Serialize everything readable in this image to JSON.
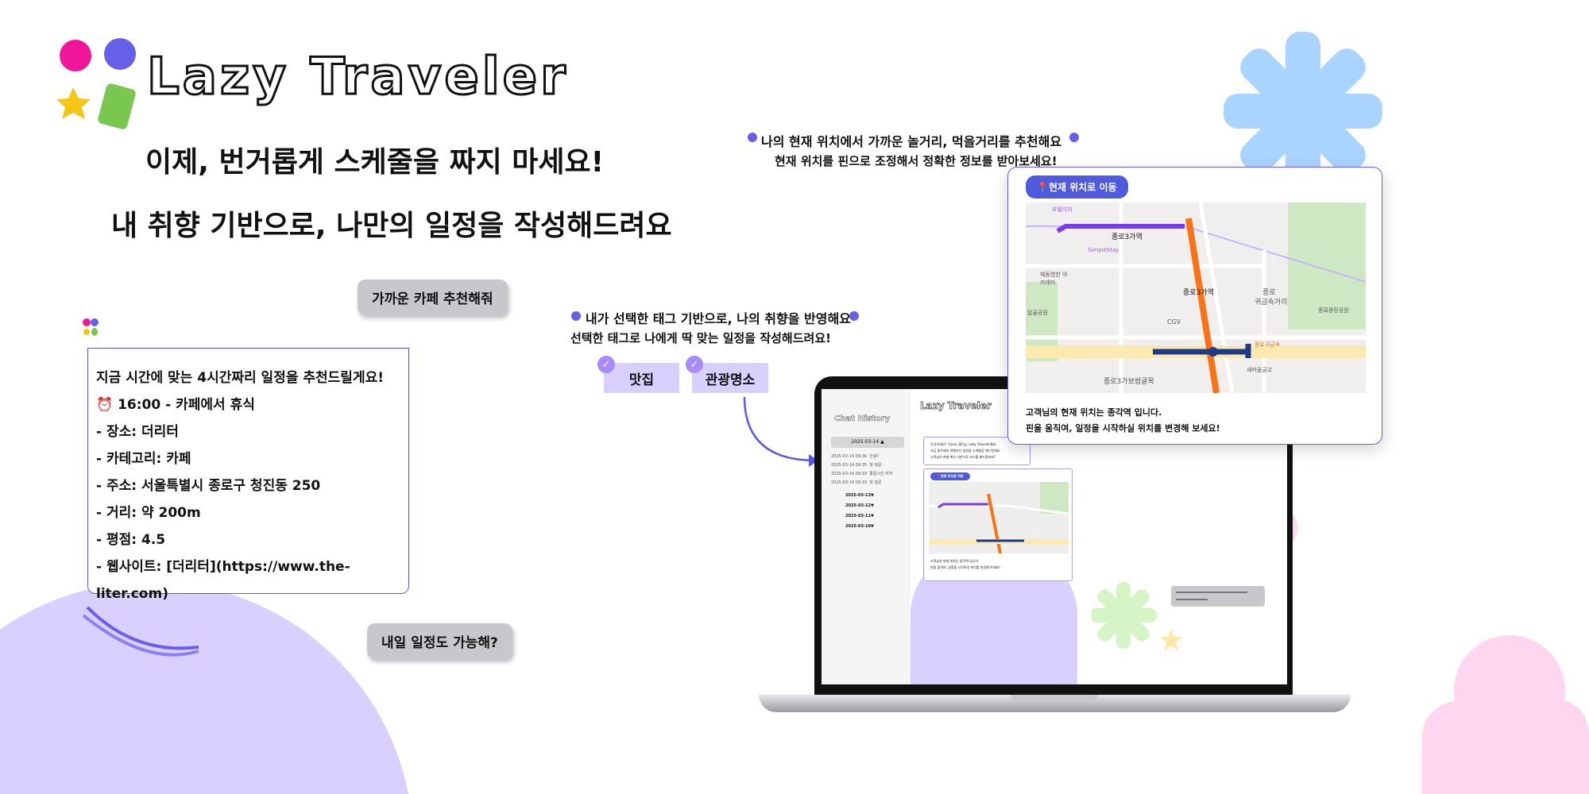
{
  "brand": {
    "title": "Lazy Traveler",
    "colors": {
      "pink": "#f0169a",
      "blue": "#6660e8",
      "yellow": "#f5c518",
      "green": "#7ac74f",
      "accent": "#5a5ae0",
      "lavender": "#d9d0ff"
    }
  },
  "headline": {
    "line1": "이제, 번거롭게 스케줄을 짜지 마세요!",
    "line2": "내 취향 기반으로, 나만의 일정을 작성해드려요"
  },
  "chat": {
    "user_msg_1": "가까운 카페 추천해줘",
    "bot_lines": [
      "지금 시간에 맞는 4시간짜리 일정을 추천드릴게요!",
      "⏰ 16:00 - 카페에서 휴식",
      "- 장소: 더리터",
      "- 카테고리: 카페",
      "- 주소: 서울특별시 종로구 청진동 250",
      "- 거리: 약 200m",
      "- 평점: 4.5",
      "- 웹사이트: [더리터](https://www.the-liter.com)"
    ],
    "user_msg_2": "내일 일정도 가능해?"
  },
  "tags_section": {
    "title": "내가 선택한 태그 기반으로, 나의 취향을 반영해요",
    "subtitle": "선택한 태그로 나에게 딱 맞는 일정을 작성해드려요!",
    "tags": [
      {
        "label": "맛집",
        "checked": true
      },
      {
        "label": "관광명소",
        "checked": true
      }
    ]
  },
  "location_section": {
    "title": "나의 현재 위치에서 가까운 놀거리, 먹을거리를 추천해요",
    "subtitle": "현재 위치를 핀으로 조정해서 정확한 정보를 받아보세요!"
  },
  "map_card": {
    "button": "📍현재 위치로 이동",
    "labels": [
      "종로3가역",
      "종로3가역",
      "종로",
      "귀금속거리",
      "종로3가보쌈골목",
      "CGV",
      "해동영한 아카데미",
      "탑골공원",
      "SimpleStay",
      "호텔이지",
      "종로귀금속",
      "새마을금고",
      "종묘광장공원"
    ],
    "info_line1": "고객님의 현재 위치는 종각역 입니다.",
    "info_line2": "핀을 움직여, 일정을 시작하실 위치를 변경해 보세요!"
  },
  "laptop": {
    "sidebar_title": "Chat History",
    "active_date": "2025-03-14 ▲",
    "entries": [
      {
        "time": "2025-03-14 09:36",
        "text": "안녕?"
      },
      {
        "time": "2025-03-14 09:35",
        "text": "첫 질문"
      },
      {
        "time": "2025-03-14 09:33",
        "text": "종일시간 여석"
      },
      {
        "time": "2025-03-14 09:33",
        "text": "첫 질문"
      }
    ],
    "dates": [
      "2025-03-13▼",
      "2025-03-12▼",
      "2025-03-11▼",
      "2025-03-10▼"
    ],
    "app_title": "Lazy Traveler",
    "greeting": [
      "안녕하세요? {User_ID}님, Lazy Traveler예요.",
      "지금 종로에서 여행하신 일정을 스케줄링 해드릴게요.",
      "고객님의 현재 위치 기반으로 코스를 짜드릴까요?"
    ],
    "map_button": "📍현재 위치로 이동",
    "map_info": [
      "고객님의 현재 위치는 종각역 입니다.",
      "핀을 움직여, 일정을 시작하실 위치를 변경해 보세요!"
    ]
  }
}
